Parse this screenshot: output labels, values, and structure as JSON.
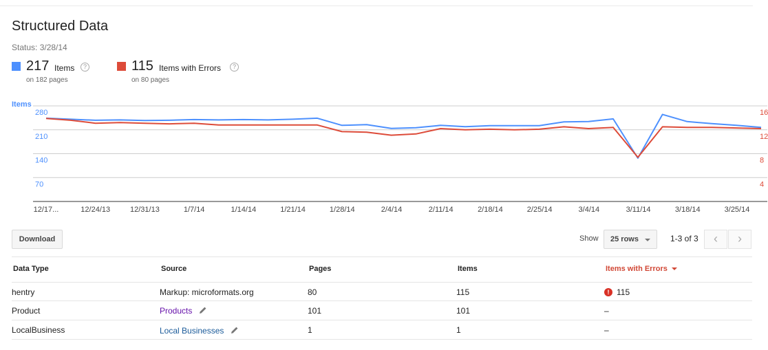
{
  "page": {
    "title": "Structured Data",
    "status": "Status: 3/28/14"
  },
  "metrics": {
    "items": {
      "value": "217",
      "label": "Items",
      "sub": "on 182 pages",
      "color": "#4d90fe"
    },
    "errors": {
      "value": "115",
      "label": "Items with Errors",
      "sub": "on 80 pages",
      "color": "#dd4b39"
    },
    "help_glyph": "?"
  },
  "chart_data": {
    "type": "line",
    "ylabel_left": "Items",
    "left_axis": {
      "range": [
        0,
        280
      ],
      "ticks": [
        280,
        210,
        140,
        70
      ]
    },
    "right_axis": {
      "range": [
        0,
        16
      ],
      "ticks": [
        16,
        12,
        8,
        4
      ]
    },
    "x_tick_labels": [
      "12/17...",
      "12/24/13",
      "12/31/13",
      "1/7/14",
      "1/14/14",
      "1/21/14",
      "1/28/14",
      "2/4/14",
      "2/11/14",
      "2/18/14",
      "2/25/14",
      "3/4/14",
      "3/11/14",
      "3/18/14",
      "3/25/14"
    ],
    "dates": [
      "12/17",
      "12/20",
      "12/24",
      "12/27",
      "12/31",
      "1/3",
      "1/7",
      "1/10",
      "1/14",
      "1/17",
      "1/21",
      "1/24",
      "1/28",
      "1/31",
      "2/4",
      "2/7",
      "2/11",
      "2/14",
      "2/18",
      "2/21",
      "2/25",
      "2/28",
      "3/4",
      "3/7",
      "3/11",
      "3/14",
      "3/18",
      "3/21",
      "3/25",
      "3/28"
    ],
    "series": [
      {
        "axis": "left",
        "color": "#4d90fe",
        "values": [
          244,
          241,
          238,
          239,
          237,
          238,
          240,
          239,
          240,
          239,
          241,
          244,
          223,
          225,
          214,
          216,
          223,
          219,
          222,
          222,
          222,
          233,
          234,
          242,
          127,
          255,
          234,
          228,
          223,
          217
        ]
      },
      {
        "axis": "right",
        "color": "#dd4b39",
        "values": [
          13.9,
          13.6,
          13.1,
          13.2,
          13.1,
          13.0,
          13.1,
          12.8,
          12.8,
          12.8,
          12.8,
          12.8,
          11.7,
          11.6,
          11.1,
          11.3,
          12.2,
          12.0,
          12.1,
          12.0,
          12.1,
          12.5,
          12.2,
          12.4,
          7.4,
          12.5,
          12.4,
          12.4,
          12.3,
          12.2
        ]
      }
    ],
    "grid": true
  },
  "toolbar": {
    "download_label": "Download",
    "show_label": "Show",
    "rows_value": "25 rows",
    "range_label": "1-3 of 3",
    "prev_glyph": "‹",
    "next_glyph": "›"
  },
  "table": {
    "headers": [
      "Data Type",
      "Source",
      "Pages",
      "Items",
      "Items with Errors"
    ],
    "rows": [
      {
        "type": "hentry",
        "source": "Markup: microformats.org",
        "pages": "80",
        "items": "115",
        "errors": "115"
      },
      {
        "type": "Product",
        "source": "Products",
        "pages": "101",
        "items": "101",
        "errors": "–"
      },
      {
        "type": "LocalBusiness",
        "source": "Local Businesses",
        "pages": "1",
        "items": "1",
        "errors": "–"
      }
    ],
    "error_icon_glyph": "!"
  }
}
